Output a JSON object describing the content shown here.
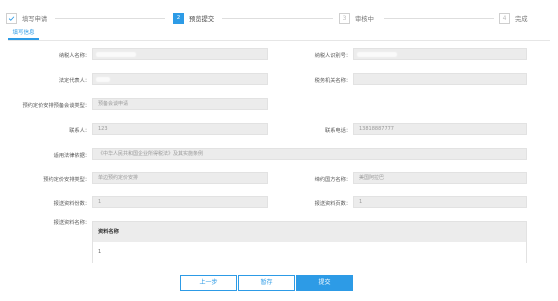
{
  "steps": [
    {
      "label": "填写申请",
      "number": "",
      "state": "done"
    },
    {
      "label": "预览提交",
      "number": "2",
      "state": "active"
    },
    {
      "label": "审核中",
      "number": "3",
      "state": "pending"
    },
    {
      "label": "完成",
      "number": "4",
      "state": "pending"
    }
  ],
  "tab": {
    "label": "填写信息"
  },
  "form": {
    "taxpayer_name": {
      "label": "纳税人名称：",
      "value": ""
    },
    "taxpayer_id": {
      "label": "纳税人识别号：",
      "value": ""
    },
    "legal_rep": {
      "label": "法定代表人：",
      "value": ""
    },
    "tax_authority": {
      "label": "税务机关名称：",
      "value": ""
    },
    "pricing_prelim_type": {
      "label": "预约定价安排预备会谈类型：",
      "value": "预备会谈申请"
    },
    "contact": {
      "label": "联系人：",
      "value": "123"
    },
    "contact_phone": {
      "label": "联系电话：",
      "value": "13818887777"
    },
    "legal_basis": {
      "label": "适用法律依据：",
      "value": "《中华人民共和国企业所得税法》及其实施条例"
    },
    "pricing_type": {
      "label": "预约定价安排类型：",
      "value": "单边预约定价安排"
    },
    "counterparty": {
      "label": "缔约国方名称：",
      "value": "美国阿拉巴"
    },
    "paper_copies": {
      "label": "报送资料份数：",
      "value": "1"
    },
    "paper_pages": {
      "label": "报送资料页数：",
      "value": "1"
    },
    "materials_label": "报送资料名称："
  },
  "materials": {
    "header": "资料名称",
    "rows": [
      "1"
    ]
  },
  "buttons": {
    "prev": "上一步",
    "save": "暂存",
    "submit": "提交"
  }
}
